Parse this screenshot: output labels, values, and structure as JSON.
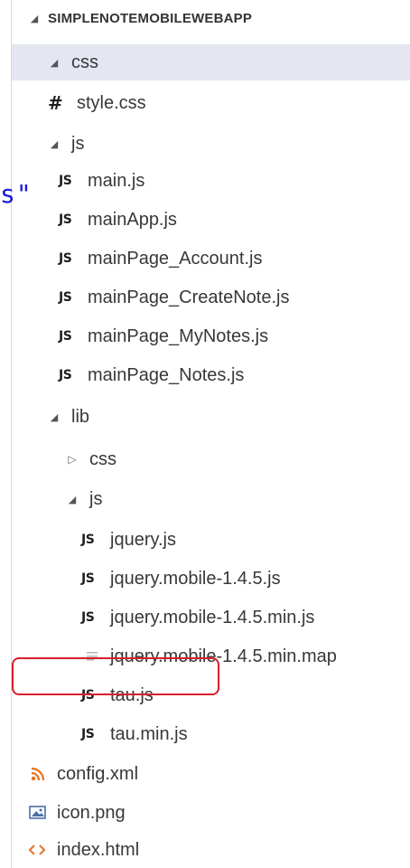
{
  "artifact_text": "s\"",
  "root": {
    "label": "SIMPLENOTEMOBILEWEBAPP"
  },
  "items": [
    {
      "label": "css",
      "icon": "folder-expanded"
    },
    {
      "label": "style.css",
      "icon": "css-hash-icon"
    },
    {
      "label": "js",
      "icon": "folder-expanded"
    },
    {
      "label": "main.js",
      "icon": "js-icon"
    },
    {
      "label": "mainApp.js",
      "icon": "js-icon"
    },
    {
      "label": "mainPage_Account.js",
      "icon": "js-icon"
    },
    {
      "label": "mainPage_CreateNote.js",
      "icon": "js-icon"
    },
    {
      "label": "mainPage_MyNotes.js",
      "icon": "js-icon"
    },
    {
      "label": "mainPage_Notes.js",
      "icon": "js-icon"
    },
    {
      "label": "lib",
      "icon": "folder-expanded"
    },
    {
      "label": "css",
      "icon": "folder-collapsed"
    },
    {
      "label": "js",
      "icon": "folder-expanded"
    },
    {
      "label": "jquery.js",
      "icon": "js-icon"
    },
    {
      "label": "jquery.mobile-1.4.5.js",
      "icon": "js-icon"
    },
    {
      "label": "jquery.mobile-1.4.5.min.js",
      "icon": "js-icon"
    },
    {
      "label": "jquery.mobile-1.4.5.min.map",
      "icon": "text-file-icon"
    },
    {
      "label": "tau.js",
      "icon": "js-icon"
    },
    {
      "label": "tau.min.js",
      "icon": "js-icon"
    },
    {
      "label": "config.xml",
      "icon": "rss-icon"
    },
    {
      "label": "icon.png",
      "icon": "image-icon"
    },
    {
      "label": "index.html",
      "icon": "html-icon"
    }
  ],
  "js_icon_text": "JS",
  "hash_icon_text": "#",
  "colors": {
    "selected_row": "#e4e6f1",
    "highlight": "#d8202a",
    "rss": "#e8731c",
    "html": "#e37933",
    "image": "#4a6fa5"
  }
}
